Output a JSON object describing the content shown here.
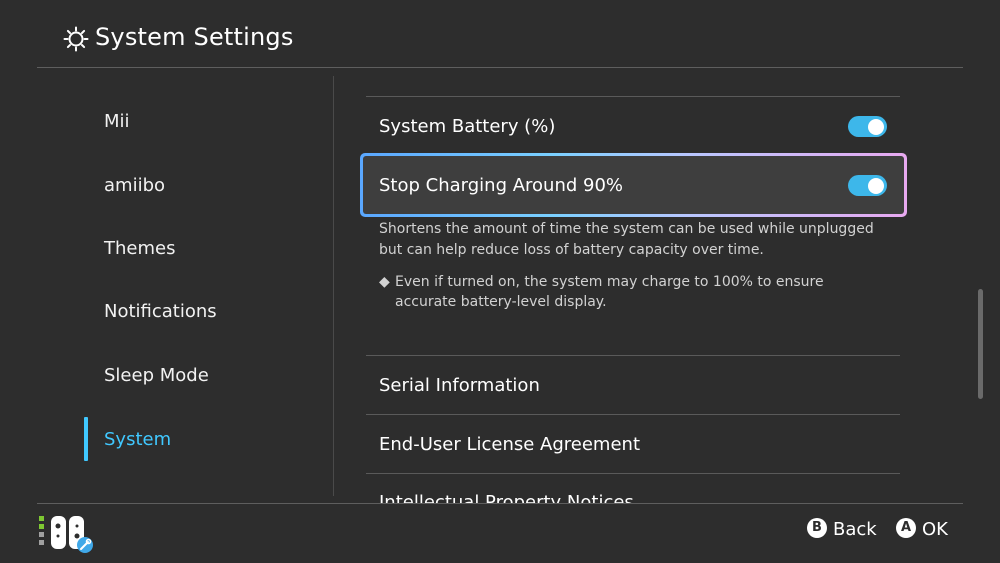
{
  "header": {
    "title": "System Settings",
    "icon": "gear-icon"
  },
  "sidebar": {
    "items": [
      {
        "label": "Mii"
      },
      {
        "label": "amiibo"
      },
      {
        "label": "Themes"
      },
      {
        "label": "Notifications"
      },
      {
        "label": "Sleep Mode"
      },
      {
        "label": "System",
        "active": true
      }
    ]
  },
  "main": {
    "rows": [
      {
        "label": "System Battery (%)",
        "toggle": true
      },
      {
        "label": "Stop Charging Around 90%",
        "toggle": true,
        "selected": true
      },
      {
        "label": "Serial Information"
      },
      {
        "label": "End-User License Agreement"
      },
      {
        "label": "Intellectual Property Notices"
      }
    ],
    "description": "Shortens the amount of time the system can be used while unplugged but can help reduce loss of battery capacity over time.",
    "note": "Even if turned on, the system may charge to 100% to ensure accurate battery-level display.",
    "note_bullet": "◆"
  },
  "footer": {
    "back": {
      "key": "B",
      "label": "Back"
    },
    "ok": {
      "key": "A",
      "label": "OK"
    }
  },
  "colors": {
    "accent": "#40c8ff",
    "toggle_on": "#3db7ea",
    "background": "#2d2d2d"
  }
}
